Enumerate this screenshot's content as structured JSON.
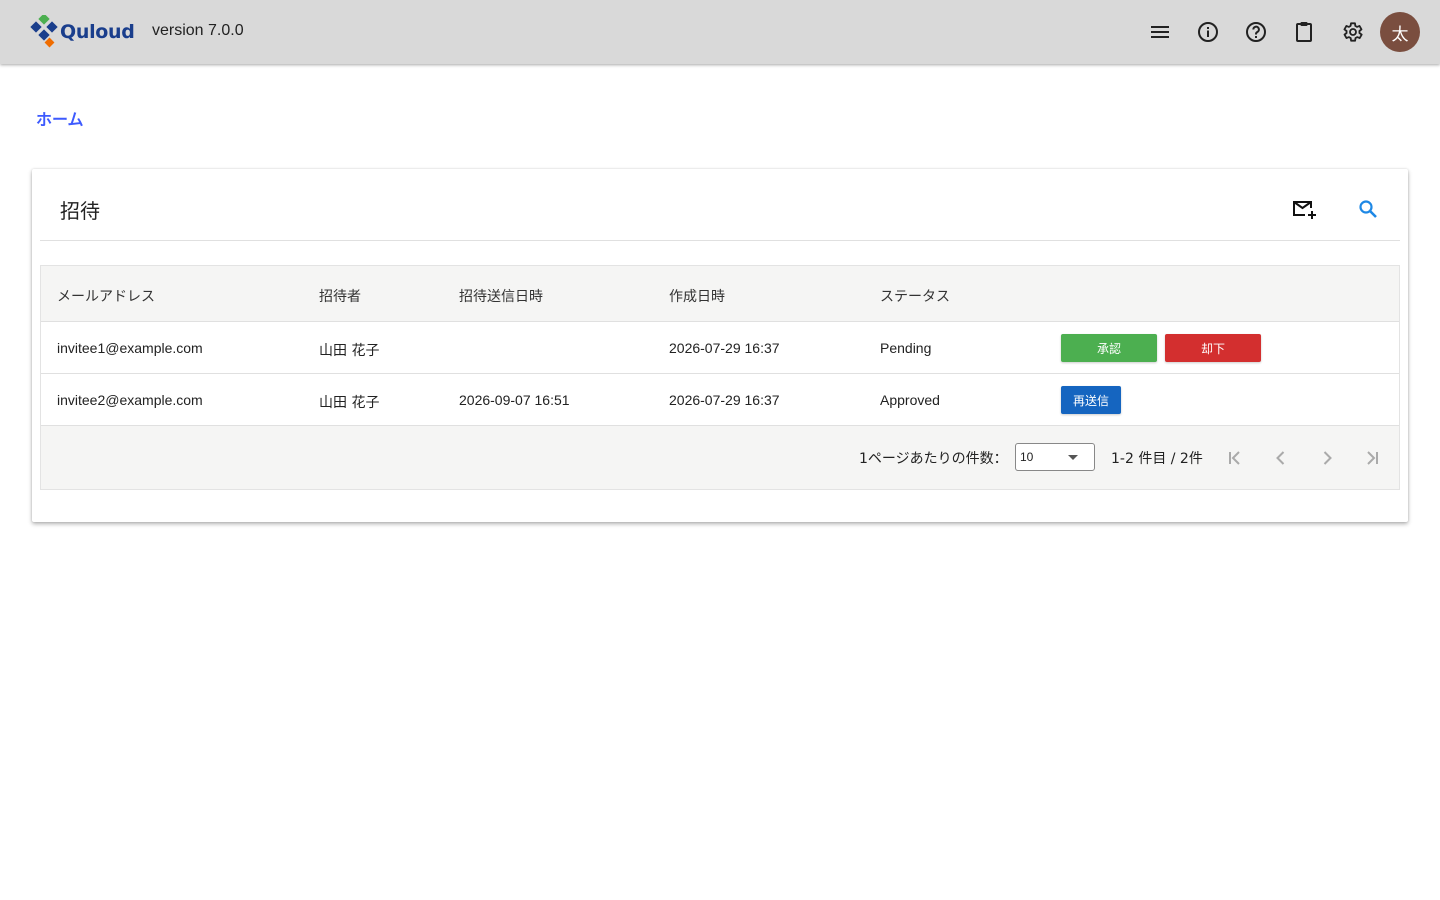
{
  "appbar": {
    "logo_text": "Quloud",
    "version": "version 7.0.0",
    "avatar_initial": "太"
  },
  "breadcrumb": {
    "home": "ホーム"
  },
  "card": {
    "title": "招待"
  },
  "table": {
    "columns": [
      "メールアドレス",
      "招待者",
      "招待送信日時",
      "作成日時",
      "ステータス"
    ],
    "rows": [
      {
        "email": "invitee1@example.com",
        "inviter": "山田 花子",
        "sent_at": "",
        "created_at": "2026-07-29 16:37",
        "status": "Pending",
        "actions": [
          "承認",
          "却下"
        ]
      },
      {
        "email": "invitee2@example.com",
        "inviter": "山田 花子",
        "sent_at": "2026-09-07 16:51",
        "created_at": "2026-07-29 16:37",
        "status": "Approved",
        "actions": [
          "再送信"
        ]
      }
    ]
  },
  "pagination": {
    "per_page_label": "1ページあたりの件数：",
    "per_page_value": "10",
    "range": "1-2 件目 / 2件"
  },
  "colors": {
    "appbar": "#d9d9d9",
    "approve": "#4caf50",
    "reject": "#d32f2f",
    "resend": "#1565c0",
    "link": "#3d5afe",
    "avatar": "#7a4e3f"
  }
}
